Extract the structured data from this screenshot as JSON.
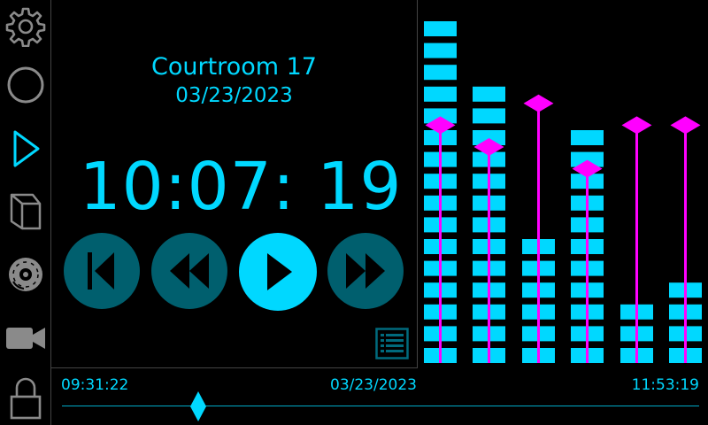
{
  "sidebar": {
    "items": [
      {
        "name": "settings",
        "icon": "gear-icon",
        "active": false
      },
      {
        "name": "stop",
        "icon": "circle-icon",
        "active": false
      },
      {
        "name": "play",
        "icon": "play-outline-icon",
        "active": true
      },
      {
        "name": "file",
        "icon": "file-icon",
        "active": false
      },
      {
        "name": "disc",
        "icon": "disc-icon",
        "active": false
      },
      {
        "name": "video",
        "icon": "video-camera-icon",
        "active": false
      },
      {
        "name": "lock",
        "icon": "lock-icon",
        "active": false
      }
    ]
  },
  "main": {
    "title": "Courtroom 17",
    "date": "03/23/2023",
    "clock": "10:07: 19"
  },
  "transport": {
    "buttons": [
      "skip-back-icon",
      "rewind-icon",
      "play-icon",
      "fast-forward-icon"
    ]
  },
  "timeline": {
    "start": "09:31:22",
    "date": "03/23/2023",
    "end": "11:53:19",
    "position": 0.214
  },
  "meter": {
    "max_segments": 16,
    "channels": [
      {
        "level": 16,
        "peak": 11
      },
      {
        "level": 13,
        "peak": 10
      },
      {
        "level": 6,
        "peak": 12
      },
      {
        "level": 11,
        "peak": 9
      },
      {
        "level": 3,
        "peak": 11
      },
      {
        "level": 4,
        "peak": 11
      }
    ]
  },
  "colors": {
    "accent": "#00d8ff",
    "dim_accent": "#005f6e",
    "peak": "#ff00ff",
    "icon_gray": "#8a8a8a"
  }
}
